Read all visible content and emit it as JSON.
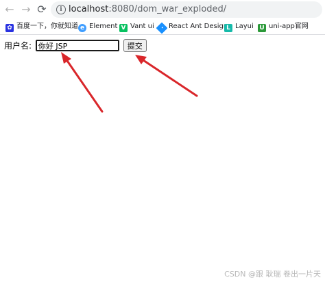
{
  "browser": {
    "nav": {
      "back": "←",
      "forward": "→",
      "reload": "⟳"
    },
    "url_host": "localhost",
    "url_rest": ":8080/dom_war_exploded/"
  },
  "bookmarks": [
    {
      "label": "百度一下，你就知道",
      "icon": "baidu-paw-icon",
      "color": "#2932e1"
    },
    {
      "label": "Element",
      "icon": "element-icon",
      "color": "#409eff"
    },
    {
      "label": "Vant ui",
      "icon": "vant-icon",
      "color": "#07c160"
    },
    {
      "label": "React Ant Design",
      "icon": "ant-design-icon",
      "color": "#1890ff"
    },
    {
      "label": "Layui",
      "icon": "layui-icon",
      "color": "#16baaa"
    },
    {
      "label": "uni-app官网",
      "icon": "uni-app-icon",
      "color": "#2b9939"
    }
  ],
  "form": {
    "label": "用户名:",
    "input_value": "你好 JSP",
    "submit_label": "提交"
  },
  "watermark": "CSDN @跟 耿瑞 卷出一片天"
}
